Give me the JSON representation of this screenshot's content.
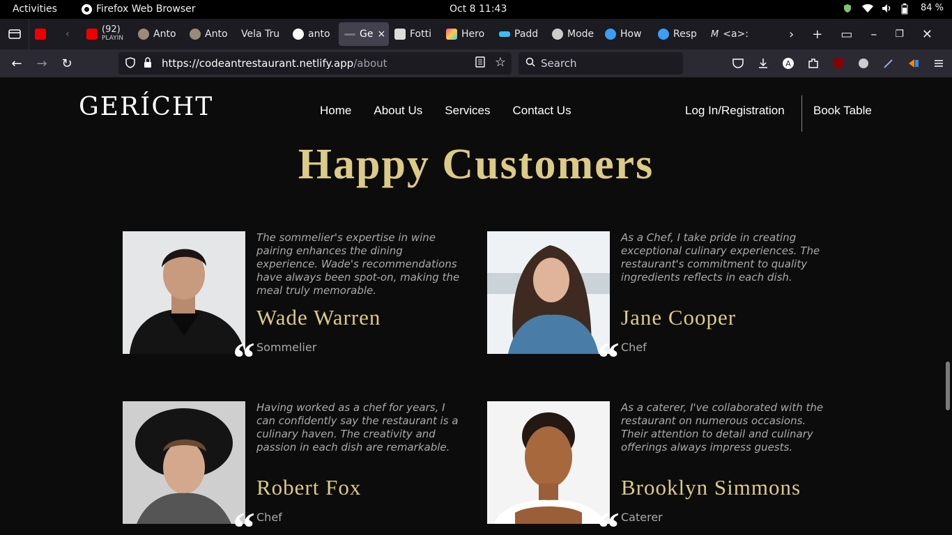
{
  "system_bar": {
    "activities": "Activities",
    "app_name": "Firefox Web Browser",
    "clock": "Oct 8  11:43",
    "battery": "84 %"
  },
  "tabs": [
    {
      "label": "",
      "icon": "youtube-icon"
    },
    {
      "label": "(92)",
      "sub": "PLAYIN",
      "icon": "youtube-icon"
    },
    {
      "label": "Anto",
      "icon": "avatar-icon"
    },
    {
      "label": "Anto",
      "icon": "avatar-icon"
    },
    {
      "label": "Vela Tru",
      "icon": "none"
    },
    {
      "label": "anto",
      "icon": "github-icon"
    },
    {
      "label": "Ge",
      "icon": "page-icon",
      "active": true
    },
    {
      "label": "Fotti",
      "icon": "notion-icon"
    },
    {
      "label": "Hero",
      "icon": "gradient-icon"
    },
    {
      "label": "Padd",
      "icon": "tailwind-icon"
    },
    {
      "label": "Mode",
      "icon": "openai-icon"
    },
    {
      "label": "How",
      "icon": "codeium-icon"
    },
    {
      "label": "Resp",
      "icon": "codeium-icon"
    },
    {
      "label": "<a>:",
      "icon": "mdn-icon"
    }
  ],
  "address": {
    "url_host": "https://codeantrestaurant.netlify.app",
    "url_path": "/about",
    "search_placeholder": "Search"
  },
  "site": {
    "logo": "GERÍCHT",
    "nav": [
      "Home",
      "About Us",
      "Services",
      "Contact Us"
    ],
    "login": "Log In/Registration",
    "book": "Book Table",
    "section_title": "Happy Customers",
    "testimonials": [
      {
        "text": "The sommelier's expertise in wine pairing enhances the dining experience. Wade's recommendations have always been spot-on, making the meal truly memorable.",
        "name": "Wade Warren",
        "role": "Sommelier"
      },
      {
        "text": "As a Chef, I take pride in creating exceptional culinary experiences. The restaurant's commitment to quality ingredients reflects in each dish.",
        "name": "Jane Cooper",
        "role": "Chef"
      },
      {
        "text": "Having worked as a chef for years, I can confidently say the restaurant is a culinary haven. The creativity and passion in each dish are remarkable.",
        "name": "Robert Fox",
        "role": "Chef"
      },
      {
        "text": "As a caterer, I've collaborated with the restaurant on numerous occasions. Their attention to detail and culinary offerings always impress guests.",
        "name": "Brooklyn Simmons",
        "role": "Caterer"
      }
    ],
    "quote_glyph": "“"
  },
  "colors": {
    "accent_gold": "#dcca87",
    "page_bg": "#0c0c0c"
  }
}
